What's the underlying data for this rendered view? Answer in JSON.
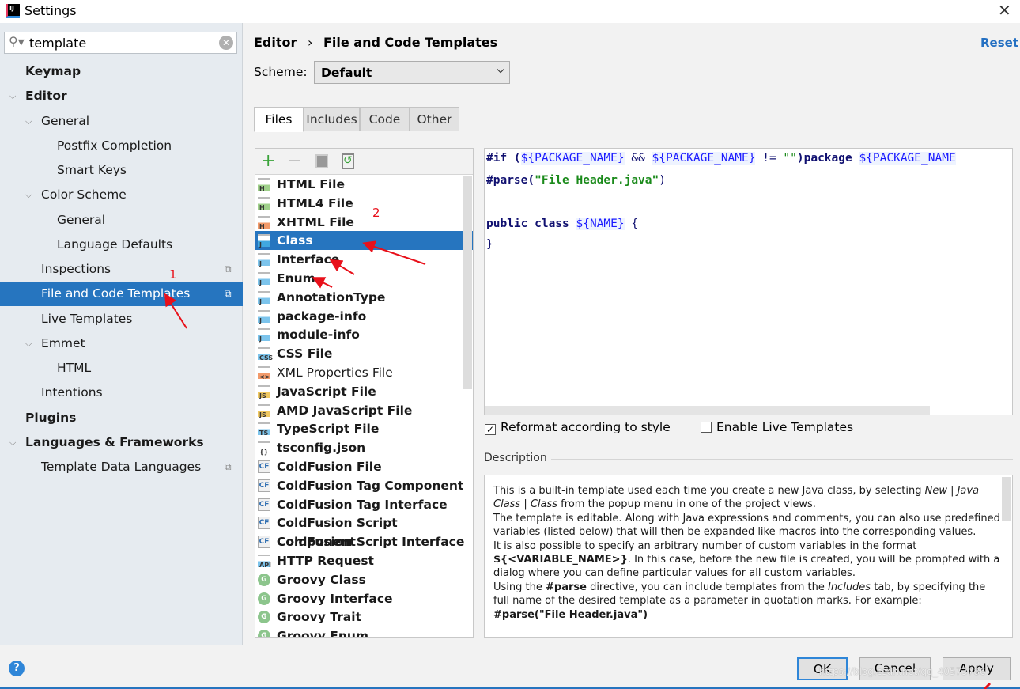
{
  "window": {
    "title": "Settings",
    "close": "✕"
  },
  "search": {
    "value": "template",
    "icon": "search-icon",
    "clear": "✕"
  },
  "sidebar": {
    "items": [
      {
        "label": "Keymap",
        "level": 0,
        "bold": true
      },
      {
        "label": "Editor",
        "level": 0,
        "bold": true,
        "expanded": true
      },
      {
        "label": "General",
        "level": 1,
        "expanded": true
      },
      {
        "label": "Postfix Completion",
        "level": 2
      },
      {
        "label": "Smart Keys",
        "level": 2
      },
      {
        "label": "Color Scheme",
        "level": 1,
        "expanded": true
      },
      {
        "label": "General",
        "level": 2
      },
      {
        "label": "Language Defaults",
        "level": 2
      },
      {
        "label": "Inspections",
        "level": 1,
        "copy": true
      },
      {
        "label": "File and Code Templates",
        "level": 1,
        "copy": true,
        "selected": true
      },
      {
        "label": "Live Templates",
        "level": 1
      },
      {
        "label": "Emmet",
        "level": 1,
        "expanded": true
      },
      {
        "label": "HTML",
        "level": 2
      },
      {
        "label": "Intentions",
        "level": 1
      },
      {
        "label": "Plugins",
        "level": 0,
        "bold": true
      },
      {
        "label": "Languages & Frameworks",
        "level": 0,
        "bold": true,
        "expanded": true
      },
      {
        "label": "Template Data Languages",
        "level": 1,
        "copy": true
      }
    ]
  },
  "header": {
    "breadcrumb_parent": "Editor",
    "separator": "›",
    "breadcrumb_current": "File and Code Templates",
    "reset": "Reset"
  },
  "scheme": {
    "label": "Scheme:",
    "value": "Default"
  },
  "tabs": [
    {
      "label": "Files",
      "active": true
    },
    {
      "label": "Includes"
    },
    {
      "label": "Code"
    },
    {
      "label": "Other"
    }
  ],
  "list_toolbar": {
    "add": "+",
    "remove": "−"
  },
  "templates": [
    {
      "label": "HTML File",
      "icon": "H",
      "color": "#9fd08a"
    },
    {
      "label": "HTML4 File",
      "icon": "H",
      "color": "#9fd08a"
    },
    {
      "label": "XHTML File",
      "icon": "H",
      "color": "#f29a6a"
    },
    {
      "label": "Class",
      "icon": "J",
      "color": "#40a8e0",
      "selected": true
    },
    {
      "label": "Interface",
      "icon": "J",
      "color": "#7cc4ec"
    },
    {
      "label": "Enum",
      "icon": "J",
      "color": "#7cc4ec"
    },
    {
      "label": "AnnotationType",
      "icon": "J",
      "color": "#7cc4ec"
    },
    {
      "label": "package-info",
      "icon": "J",
      "color": "#7cc4ec"
    },
    {
      "label": "module-info",
      "icon": "J",
      "color": "#7cc4ec"
    },
    {
      "label": "CSS File",
      "icon": "CSS",
      "color": "#7cc4ec"
    },
    {
      "label": "XML Properties File",
      "icon": "<>",
      "color": "#f29a6a",
      "normal": true
    },
    {
      "label": "JavaScript File",
      "icon": "JS",
      "color": "#f0c860"
    },
    {
      "label": "AMD JavaScript File",
      "icon": "JS",
      "color": "#f0c860"
    },
    {
      "label": "TypeScript File",
      "icon": "TS",
      "color": "#7cc4ec"
    },
    {
      "label": "tsconfig.json",
      "icon": "{}",
      "color": "#ffffff"
    },
    {
      "label": "ColdFusion File",
      "icon": "CF",
      "kind": "cf"
    },
    {
      "label": "ColdFusion Tag Component",
      "icon": "CF",
      "kind": "cf"
    },
    {
      "label": "ColdFusion Tag Interface",
      "icon": "CF",
      "kind": "cf"
    },
    {
      "label": "ColdFusion Script Component",
      "icon": "CF",
      "kind": "cf"
    },
    {
      "label": "ColdFusion Script Interface",
      "icon": "CF",
      "kind": "cf"
    },
    {
      "label": "HTTP Request",
      "icon": "API",
      "color": "#7cc4ec"
    },
    {
      "label": "Groovy Class",
      "icon": "G",
      "kind": "g"
    },
    {
      "label": "Groovy Interface",
      "icon": "G",
      "kind": "g"
    },
    {
      "label": "Groovy Trait",
      "icon": "G",
      "kind": "g"
    },
    {
      "label": "Groovy Enum",
      "icon": "G",
      "kind": "g"
    }
  ],
  "code": {
    "l1": {
      "a": "#if (",
      "v1": "${PACKAGE_NAME}",
      "b": " && ",
      "v2": "${PACKAGE_NAME}",
      "c": " != ",
      "s": "\"\"",
      "d": ")package ",
      "v3": "${PACKAGE_NAME"
    },
    "l2": {
      "a": "#parse(",
      "s": "\"File Header.java\"",
      "b": ")"
    },
    "l4": {
      "a": "public class ",
      "v": "${NAME}",
      "b": " {"
    },
    "l5": "}"
  },
  "options": {
    "reformat": "Reformat according to style",
    "reformat_checked": true,
    "live": "Enable Live Templates",
    "live_checked": false
  },
  "description": {
    "label": "Description",
    "p1a": "This is a built-in template used each time you create a new Java class, by selecting ",
    "p1i": "New | Java Class | Class",
    "p1b": " from the popup menu in one of the project views.",
    "p2": "The template is editable. Along with Java expressions and comments, you can also use predefined variables (listed below) that will then be expanded like macros into the corresponding values.",
    "p3a": "It is also possible to specify an arbitrary number of custom variables in the format ",
    "p3b": "${<VARIABLE_NAME>}",
    "p3c": ". In this case, before the new file is created, you will be prompted with a dialog where you can define particular values for all custom variables.",
    "p4a": "Using the ",
    "p4b": "#parse",
    "p4c": " directive, you can include templates from the ",
    "p4i": "Includes",
    "p4d": " tab, by specifying the full name of the desired template as a parameter in quotation marks. For example:",
    "p5": "#parse(\"File Header.java\")"
  },
  "footer": {
    "help": "?",
    "ok": "OK",
    "cancel": "Cancel",
    "apply": "Apply",
    "watermark": "https://blog.csdn.net/qq_40573786"
  },
  "annotations": {
    "n1": "1",
    "n2": "2",
    "color": "#e8101a"
  },
  "colors": {
    "selection": "#2675bf",
    "link": "#2470c2"
  }
}
